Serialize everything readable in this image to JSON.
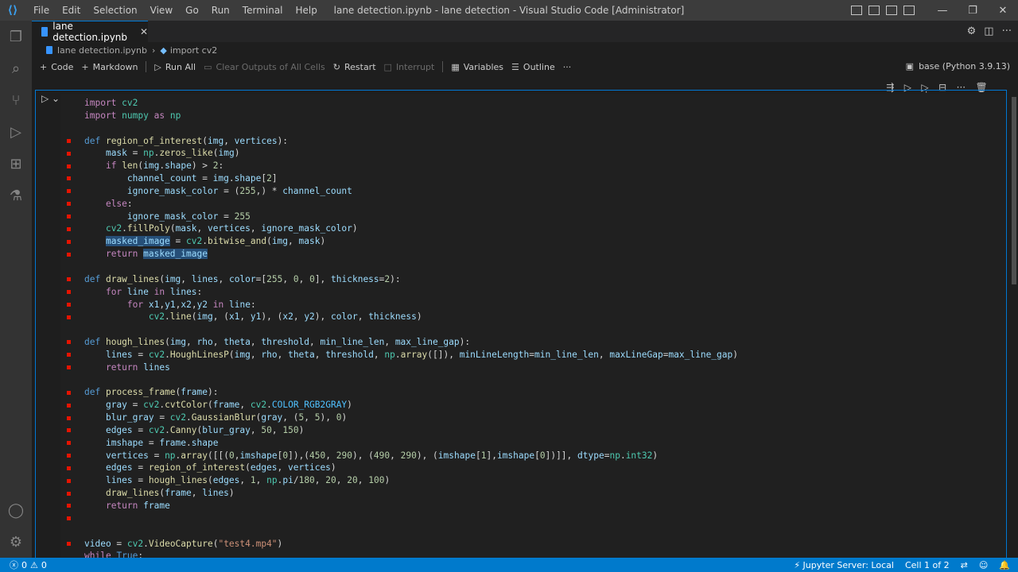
{
  "window": {
    "title": "lane detection.ipynb - lane detection - Visual Studio Code [Administrator]",
    "menu": [
      "File",
      "Edit",
      "Selection",
      "View",
      "Go",
      "Run",
      "Terminal",
      "Help"
    ]
  },
  "tab": {
    "label": "lane detection.ipynb",
    "close": "✕"
  },
  "breadcrumb": {
    "file": "lane detection.ipynb",
    "symbol": "import cv2"
  },
  "toolbar": {
    "code": "Code",
    "markdown": "Markdown",
    "run_all": "Run All",
    "clear_outputs": "Clear Outputs of All Cells",
    "restart": "Restart",
    "interrupt": "Interrupt",
    "variables": "Variables",
    "outline": "Outline",
    "more": "···",
    "kernel": "base (Python 3.9.13)"
  },
  "status": {
    "errors": "0",
    "warnings": "0",
    "jupyter_server": "Jupyter Server: Local",
    "cell_position": "Cell 1 of 2"
  },
  "colors": {
    "accent": "#007acc",
    "breakpoint": "#e51400",
    "selection": "#264f78"
  },
  "icons": [
    "vscode-logo",
    "explorer-icon",
    "search-icon",
    "source-control-icon",
    "run-debug-icon",
    "extensions-icon",
    "testing-icon",
    "account-icon",
    "manage-gear-icon"
  ]
}
